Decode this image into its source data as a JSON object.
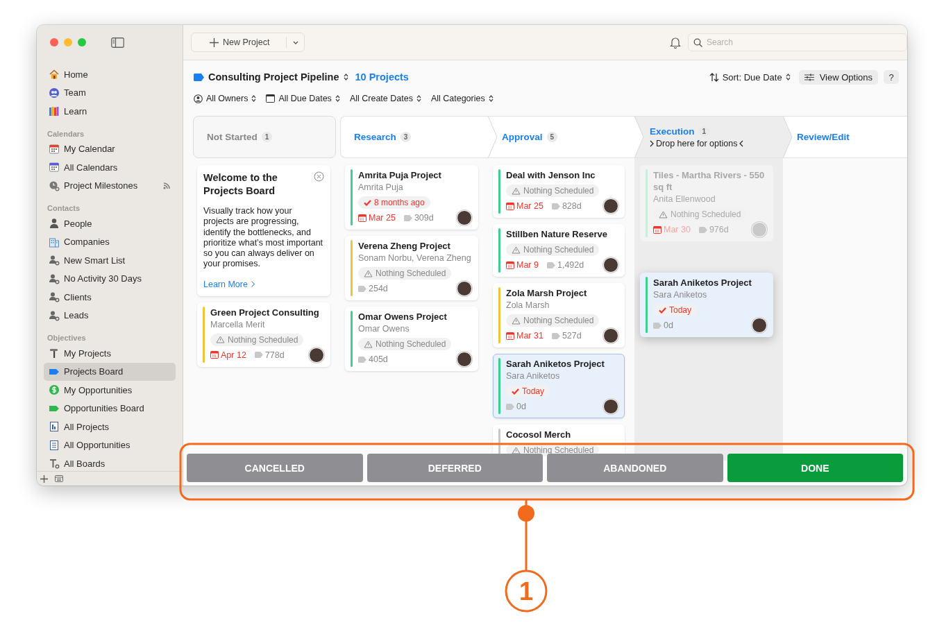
{
  "sidebar": {
    "sections": [
      {
        "items": [
          {
            "label": "Home",
            "selected": false
          },
          {
            "label": "Team",
            "selected": false
          },
          {
            "label": "Learn",
            "selected": false
          }
        ]
      },
      {
        "title": "Calendars",
        "items": [
          {
            "label": "My Calendar",
            "selected": false
          },
          {
            "label": "All Calendars",
            "selected": false
          },
          {
            "label": "Project Milestones",
            "selected": false
          }
        ]
      },
      {
        "title": "Contacts",
        "items": [
          {
            "label": "People",
            "selected": false
          },
          {
            "label": "Companies",
            "selected": false
          },
          {
            "label": "New Smart List",
            "selected": false
          },
          {
            "label": "No Activity 30 Days",
            "selected": false
          },
          {
            "label": "Clients",
            "selected": false
          },
          {
            "label": "Leads",
            "selected": false
          }
        ]
      },
      {
        "title": "Objectives",
        "items": [
          {
            "label": "My Projects",
            "selected": false
          },
          {
            "label": "Projects Board",
            "selected": true
          },
          {
            "label": "My Opportunities",
            "selected": false
          },
          {
            "label": "Opportunities Board",
            "selected": false
          },
          {
            "label": "All Projects",
            "selected": false
          },
          {
            "label": "All Opportunities",
            "selected": false
          },
          {
            "label": "All Boards",
            "selected": false
          }
        ]
      }
    ]
  },
  "toolbar": {
    "new_button": "New Project",
    "search": {
      "placeholder": "Search"
    }
  },
  "header": {
    "title": "Consulting Project Pipeline",
    "count": "10 Projects",
    "sort": "Sort: Due Date",
    "view_options": "View Options",
    "help": "?"
  },
  "filters": [
    "All Owners",
    "All Due Dates",
    "All Create Dates",
    "All Categories"
  ],
  "stages": [
    {
      "name": "Not Started",
      "count": "1",
      "drop_target": false,
      "cards": [
        {
          "kind": "welcome",
          "title": "Welcome to the Projects Board",
          "body": "Visually track how your projects are progressing, identify the bottlenecks, and prioritize what’s most important so you can always deliver on your promises.",
          "link": "Learn More"
        },
        {
          "kind": "project",
          "selected": false,
          "dimmed": false,
          "title": "Green Project Consulting",
          "subtitle": "Marcella Merit",
          "color": "#f0c53c",
          "status": {
            "kind": "warning",
            "text": "Nothing Scheduled"
          },
          "due": "Apr 12",
          "duration": "778d"
        }
      ]
    },
    {
      "name": "Research",
      "count": "3",
      "drop_target": false,
      "cards": [
        {
          "kind": "project",
          "selected": false,
          "dimmed": false,
          "title": "Amrita Puja Project",
          "subtitle": "Amrita Puja",
          "color": "#3ccf8e",
          "status": {
            "kind": "done",
            "text": "8 months ago"
          },
          "due": "Mar 25",
          "duration": "309d"
        },
        {
          "kind": "project",
          "selected": false,
          "dimmed": false,
          "title": "Verena Zheng Project",
          "subtitle": "Sonam Norbu, Verena Zheng",
          "color": "#f0c53c",
          "status": {
            "kind": "warning",
            "text": "Nothing Scheduled"
          },
          "duration": "254d"
        },
        {
          "kind": "project",
          "selected": false,
          "dimmed": false,
          "title": "Omar Owens Project",
          "subtitle": "Omar Owens",
          "color": "#3ccf8e",
          "status": {
            "kind": "warning",
            "text": "Nothing Scheduled"
          },
          "duration": "405d"
        }
      ]
    },
    {
      "name": "Approval",
      "count": "5",
      "drop_target": false,
      "cards": [
        {
          "kind": "project",
          "selected": false,
          "dimmed": false,
          "title": "Deal with Jenson Inc",
          "color": "#3ccf8e",
          "status": {
            "kind": "warning",
            "text": "Nothing Scheduled"
          },
          "due": "Mar 25",
          "duration": "828d"
        },
        {
          "kind": "project",
          "selected": false,
          "dimmed": false,
          "title": "Stillben Nature Reserve",
          "color": "#3ccf8e",
          "status": {
            "kind": "warning",
            "text": "Nothing Scheduled"
          },
          "due": "Mar 9",
          "duration": "1,492d"
        },
        {
          "kind": "project",
          "selected": false,
          "dimmed": false,
          "title": "Zola Marsh Project",
          "subtitle": "Zola Marsh",
          "color": "#f0c53c",
          "status": {
            "kind": "warning",
            "text": "Nothing Scheduled"
          },
          "due": "Mar 31",
          "duration": "527d"
        },
        {
          "kind": "project",
          "selected": true,
          "dimmed": false,
          "title": "Sarah Aniketos Project",
          "subtitle": "Sara Aniketos",
          "color": "#3ccf8e",
          "status": {
            "kind": "done",
            "text": "Today"
          },
          "duration": "0d"
        },
        {
          "kind": "project",
          "selected": false,
          "dimmed": false,
          "title": "Cocosol Merch",
          "color": "#c8c8c8",
          "status": {
            "kind": "warning",
            "text": "Nothing Scheduled"
          }
        }
      ]
    },
    {
      "name": "Execution",
      "count": "1",
      "hint": "Drop here for options",
      "drop_target": true,
      "cards": [
        {
          "kind": "project",
          "selected": false,
          "dimmed": true,
          "title": "Tiles - Martha Rivers - 550 sq ft",
          "subtitle": "Anita Ellenwood",
          "color": "#c9eedc",
          "status": {
            "kind": "warning",
            "text": "Nothing Scheduled"
          },
          "due": "Mar 30",
          "duration": "976d"
        },
        {
          "kind": "project",
          "selected": true,
          "dimmed": false,
          "title": "Sarah Aniketos Project",
          "subtitle": "Sara Aniketos",
          "color": "#3ccf8e",
          "status": {
            "kind": "done",
            "text": "Today"
          },
          "duration": "0d"
        }
      ]
    },
    {
      "name": "Review/Edit",
      "drop_target": false
    }
  ],
  "drop_bar": [
    {
      "label": "CANCELLED",
      "color": "#8e8e93"
    },
    {
      "label": "DEFERRED",
      "color": "#8e8e93"
    },
    {
      "label": "ABANDONED",
      "color": "#8e8e93"
    },
    {
      "label": "DONE",
      "color": "#0a9c3c"
    }
  ],
  "callout": {
    "number": "1"
  }
}
